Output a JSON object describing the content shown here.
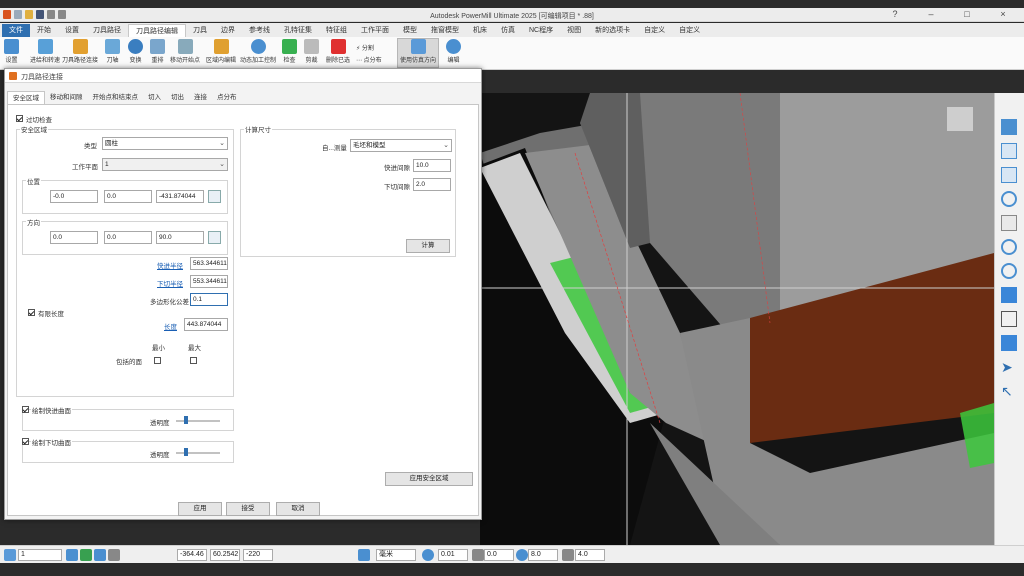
{
  "titlebar": {
    "title": "Autodesk PowerMill Ultimate 2025 [可编辑项目 * .88]"
  },
  "menu": [
    "文件",
    "开始",
    "设置",
    "刀具路径",
    "刀具路径编辑",
    "刀具",
    "边界",
    "参考线",
    "孔特征集",
    "特征组",
    "工作平面",
    "模型",
    "拖窗模型",
    "机床",
    "仿真",
    "NC程序",
    "视图",
    "新的选项卡",
    "自定义",
    "自定义"
  ],
  "ribbon": {
    "buttons": [
      "设置",
      "进给和转速",
      "刀具路径连接",
      "刀轴",
      "变换",
      "重排",
      "移动开始点",
      "区域内编辑",
      "动态加工控制",
      "检查",
      "剪裁",
      "删除已选",
      "使用仿真方向",
      "编辑"
    ],
    "split_label": "分割",
    "distribute_label": "点分布"
  },
  "dialog": {
    "title": "刀具路径连接",
    "tabs": [
      "安全区域",
      "移动和间隙",
      "开始点和结束点",
      "切入",
      "切出",
      "连接",
      "点分布"
    ],
    "gouge_check": "过切检查",
    "safe_area": {
      "group": "安全区域",
      "type_label": "类型",
      "type_value": "圆柱",
      "workplane_label": "工作平面",
      "workplane_value": "1",
      "position_label": "位置",
      "position": [
        "-0.0",
        "0.0",
        "-431.874044"
      ],
      "direction_label": "方向",
      "direction": [
        "0.0",
        "0.0",
        "90.0"
      ],
      "rapid_radius_label": "快进半径",
      "rapid_radius": "563.344611",
      "plunge_radius_label": "下切半径",
      "plunge_radius": "553.344611",
      "poly_tol_label": "多边形化公差",
      "poly_tol": "0.1"
    },
    "finite_length": {
      "label": "有限长度",
      "length_label": "长度",
      "length": "443.874044",
      "min_label": "最小",
      "max_label": "最大",
      "include_label": "包括的面"
    },
    "rapid_surface": {
      "label": "绘制快进曲面",
      "transparency_label": "透明度"
    },
    "plunge_surface": {
      "label": "绘制下切曲面",
      "transparency_label": "透明度"
    },
    "calc": {
      "group": "计算尺寸",
      "auto_label": "自...测量",
      "auto_value": "毛坯和模型",
      "rapid_gap_label": "快进间隙",
      "rapid_gap": "10.0",
      "plunge_gap_label": "下切间隙",
      "plunge_gap": "2.0",
      "calc_button": "计算"
    },
    "apply_safe_button": "应用安全区域",
    "apply_button": "应用",
    "accept_button": "接受",
    "cancel_button": "取消"
  },
  "statusbar": {
    "layer": "1",
    "x": "-364.46",
    "y": "60.2542",
    "z": "-220",
    "units": "毫米",
    "tol": "0.01",
    "thick": "0.0",
    "step": "8.0",
    "angle": "4.0"
  },
  "colors": {
    "accent": "#2f6fb0",
    "green": "#3cc83c",
    "brown": "#6a2c12",
    "gray": "#9a9a9a"
  }
}
